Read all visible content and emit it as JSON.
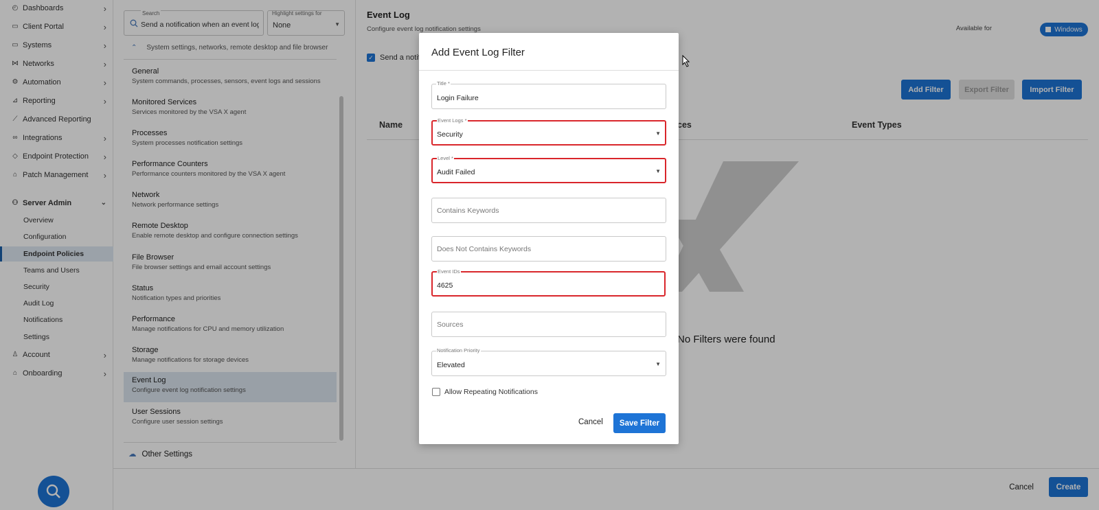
{
  "nav": {
    "items": [
      {
        "label": "Dashboards",
        "icon": "gauge-icon",
        "chevron": true
      },
      {
        "label": "Client Portal",
        "icon": "window-icon",
        "chevron": true
      },
      {
        "label": "Systems",
        "icon": "monitor-icon",
        "chevron": true
      },
      {
        "label": "Networks",
        "icon": "network-icon",
        "chevron": true
      },
      {
        "label": "Automation",
        "icon": "automation-icon",
        "chevron": true
      },
      {
        "label": "Reporting",
        "icon": "chart-icon",
        "chevron": true
      },
      {
        "label": "Advanced Reporting",
        "icon": "trend-icon",
        "chevron": false
      },
      {
        "label": "Integrations",
        "icon": "link-icon",
        "chevron": true
      },
      {
        "label": "Endpoint Protection",
        "icon": "shield-icon",
        "chevron": true
      },
      {
        "label": "Patch Management",
        "icon": "patch-icon",
        "chevron": true
      }
    ],
    "server_admin": {
      "label": "Server Admin",
      "icon": "server-admin-icon"
    },
    "sub_items": [
      "Overview",
      "Configuration",
      "Endpoint Policies",
      "Teams and Users",
      "Security",
      "Audit Log",
      "Notifications",
      "Settings"
    ],
    "active_sub": "Endpoint Policies",
    "bottom_items": [
      {
        "label": "Account",
        "icon": "person-icon"
      },
      {
        "label": "Onboarding",
        "icon": "graduation-icon"
      }
    ]
  },
  "settings": {
    "search_label": "Search",
    "search_value": "Send a notification when an event log",
    "highlight_label": "Highlight settings for",
    "highlight_value": "None",
    "system_line": "System settings, networks, remote desktop and file browser",
    "items": [
      {
        "title": "General",
        "desc": "System commands, processes, sensors, event logs and sessions"
      },
      {
        "title": "Monitored Services",
        "desc": "Services monitored by the VSA X agent"
      },
      {
        "title": "Processes",
        "desc": "System processes notification settings"
      },
      {
        "title": "Performance Counters",
        "desc": "Performance counters monitored by the VSA X agent"
      },
      {
        "title": "Network",
        "desc": "Network performance settings"
      },
      {
        "title": "Remote Desktop",
        "desc": "Enable remote desktop and configure connection settings"
      },
      {
        "title": "File Browser",
        "desc": "File browser settings and email account settings"
      },
      {
        "title": "Status",
        "desc": "Notification types and priorities"
      },
      {
        "title": "Performance",
        "desc": "Manage notifications for CPU and memory utilization"
      },
      {
        "title": "Storage",
        "desc": "Manage notifications for storage devices"
      },
      {
        "title": "Event Log",
        "desc": "Configure event log notification settings"
      },
      {
        "title": "User Sessions",
        "desc": "Configure user session settings"
      }
    ],
    "active_item": "Event Log",
    "other_settings": "Other Settings"
  },
  "main": {
    "title": "Event Log",
    "subtitle": "Configure event log notification settings",
    "available_for": "Available for",
    "platform": "Windows",
    "send_notification_label": "Send a notifi",
    "buttons": {
      "add": "Add Filter",
      "export": "Export Filter",
      "import": "Import Filter"
    },
    "columns": {
      "name": "Name",
      "sources": "ces",
      "event_types": "Event Types"
    },
    "empty_message": "No Filters were found"
  },
  "footer": {
    "cancel": "Cancel",
    "create": "Create"
  },
  "modal": {
    "title": "Add Event Log Filter",
    "fields": {
      "title": {
        "label": "Title *",
        "value": "Login Failure"
      },
      "event_logs": {
        "label": "Event Logs *",
        "value": "Security"
      },
      "level": {
        "label": "Level *",
        "value": "Audit Failed"
      },
      "contains_keywords": {
        "placeholder": "Contains Keywords"
      },
      "not_contains_keywords": {
        "placeholder": "Does Not Contains Keywords"
      },
      "event_ids": {
        "label": "Event IDs",
        "value": "4625"
      },
      "sources": {
        "placeholder": "Sources"
      },
      "priority": {
        "label": "Notification Priority",
        "value": "Elevated"
      }
    },
    "allow_repeating": "Allow Repeating Notifications",
    "cancel": "Cancel",
    "save": "Save Filter"
  },
  "colors": {
    "accent": "#1e74d6",
    "highlight_border": "#d9252a",
    "active_bg": "#dce6f0"
  }
}
